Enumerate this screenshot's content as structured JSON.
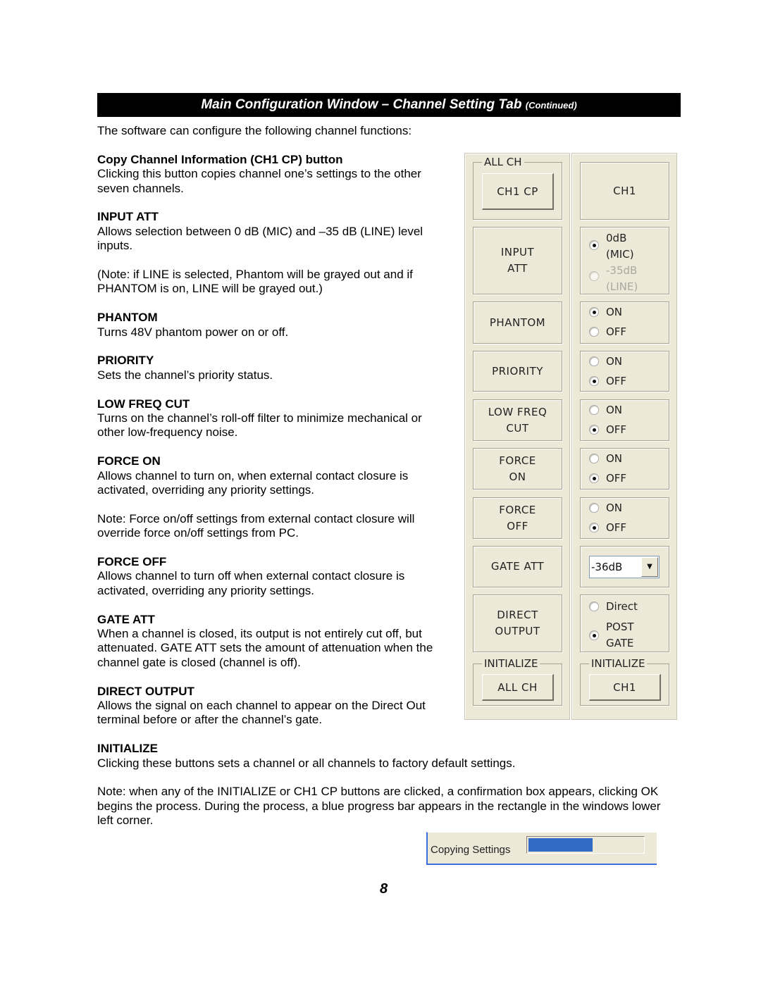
{
  "title": {
    "main": "Main Configuration Window – Channel Setting Tab",
    "suffix": "(Continued)"
  },
  "intro": "The software can configure the following channel functions:",
  "sections": [
    {
      "heading": "Copy Channel Information (CH1 CP) button",
      "lines": [
        "Clicking this button copies channel one’s settings to the other",
        "seven channels."
      ]
    },
    {
      "heading": "INPUT ATT",
      "lines": [
        "Allows selection between 0 dB (MIC) and –35 dB (LINE) level",
        "inputs."
      ],
      "note": [
        "(Note: if LINE is selected, Phantom will be grayed out and if",
        "PHANTOM is on, LINE will be grayed out.)"
      ]
    },
    {
      "heading": "PHANTOM",
      "lines": [
        "Turns 48V phantom power on or off."
      ]
    },
    {
      "heading": "PRIORITY",
      "lines": [
        "Sets the channel’s priority status."
      ]
    },
    {
      "heading": "LOW FREQ CUT",
      "lines": [
        "Turns on the channel’s roll-off filter to minimize mechanical or",
        "other low-frequency noise."
      ]
    },
    {
      "heading": "FORCE ON",
      "lines": [
        "Allows channel to turn on, when external contact closure is",
        "activated, overriding any priority settings."
      ],
      "note": [
        "Note:  Force on/off settings from external contact closure will",
        "override force on/off settings from PC."
      ]
    },
    {
      "heading": "FORCE OFF",
      "lines": [
        "Allows channel to turn off when external contact closure is",
        "activated, overriding any priority settings."
      ]
    },
    {
      "heading": "GATE ATT",
      "lines": [
        "When a channel is closed, its output is not entirely cut off, but",
        "attenuated.  GATE ATT sets the amount of attenuation when the",
        "channel gate is closed (channel is off)."
      ]
    },
    {
      "heading": "DIRECT OUTPUT",
      "lines": [
        "Allows the signal on each channel to appear on the Direct Out",
        "terminal before or after the channel’s gate."
      ]
    },
    {
      "heading": "INITIALIZE",
      "lines": [
        "Clicking these buttons sets a channel or all channels to factory default settings."
      ]
    }
  ],
  "final_note": [
    "Note: when any of the INITIALIZE or CH1 CP buttons are clicked, a confirmation box appears, clicking OK",
    "begins the process. During the process, a blue progress bar appears in the rectangle in the windows lower",
    "left corner."
  ],
  "ui": {
    "all_ch_group": "ALL CH",
    "ch1_cp": "CH1 CP",
    "ch1_label": "CH1",
    "labels": {
      "input_att": [
        "INPUT",
        "ATT"
      ],
      "phantom": "PHANTOM",
      "priority": "PRIORITY",
      "low_freq": [
        "LOW FREQ",
        "CUT"
      ],
      "force_on": [
        "FORCE",
        "ON"
      ],
      "force_off": [
        "FORCE",
        "OFF"
      ],
      "gate_att": "GATE ATT",
      "direct_output": [
        "DIRECT",
        "OUTPUT"
      ]
    },
    "input_att": {
      "opt1": [
        "0dB",
        "(MIC)"
      ],
      "opt2": [
        "-35dB",
        "(LINE)"
      ],
      "selected": "0dB (MIC)",
      "opt2_disabled": true
    },
    "on": "ON",
    "off": "OFF",
    "phantom_selected": "ON",
    "priority_selected": "OFF",
    "low_freq_selected": "OFF",
    "force_on_selected": "OFF",
    "force_off_selected": "OFF",
    "gate_att_value": "-36dB",
    "direct": {
      "opt1": "Direct",
      "opt2": [
        "POST",
        "GATE"
      ],
      "selected": "POST GATE"
    },
    "init_group": "INITIALIZE",
    "init_all": "ALL CH",
    "init_ch1": "CH1",
    "bg_color": "#ece9d8"
  },
  "progress": {
    "label": "Copying Settings",
    "percent": 56,
    "color": "#316ac5"
  },
  "page_number": "8"
}
